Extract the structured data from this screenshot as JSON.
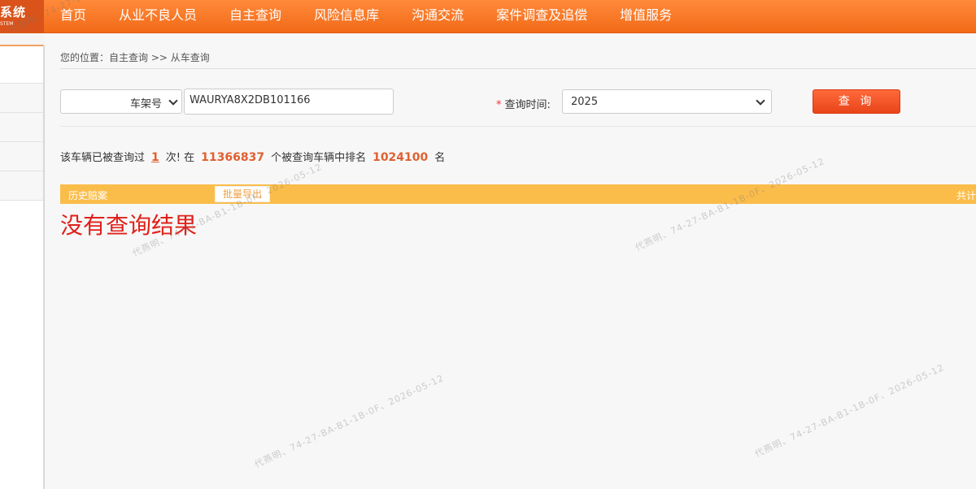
{
  "header": {
    "logo_main": "系统",
    "logo_sub": "STEM",
    "nav": [
      {
        "label": "首页"
      },
      {
        "label": "从业不良人员"
      },
      {
        "label": "自主查询"
      },
      {
        "label": "风险信息库"
      },
      {
        "label": "沟通交流"
      },
      {
        "label": "案件调查及追偿"
      },
      {
        "label": "增值服务"
      }
    ]
  },
  "breadcrumb": "您的位置：自主查询 >> 从车查询",
  "search": {
    "type_value": "车架号",
    "vin_value": "WAURYA8X2DB101166",
    "time_label": "查询时间:",
    "required_mark": "*",
    "time_value": "2025",
    "query_label": "查 询"
  },
  "stats": {
    "prefix": "该车辆已被查询过",
    "count": "1",
    "mid1": "次! 在",
    "total_vehicles": "11366837",
    "mid2": "个被查询车辆中排名",
    "rank": "1024100",
    "suffix": "名"
  },
  "history": {
    "title": "历史赔案",
    "export_label": "批量导出",
    "total_label": "共计"
  },
  "no_result": "没有查询结果",
  "watermark_text": "代燕明、74-27-BA-B1-1B-0F、2026-05-12"
}
